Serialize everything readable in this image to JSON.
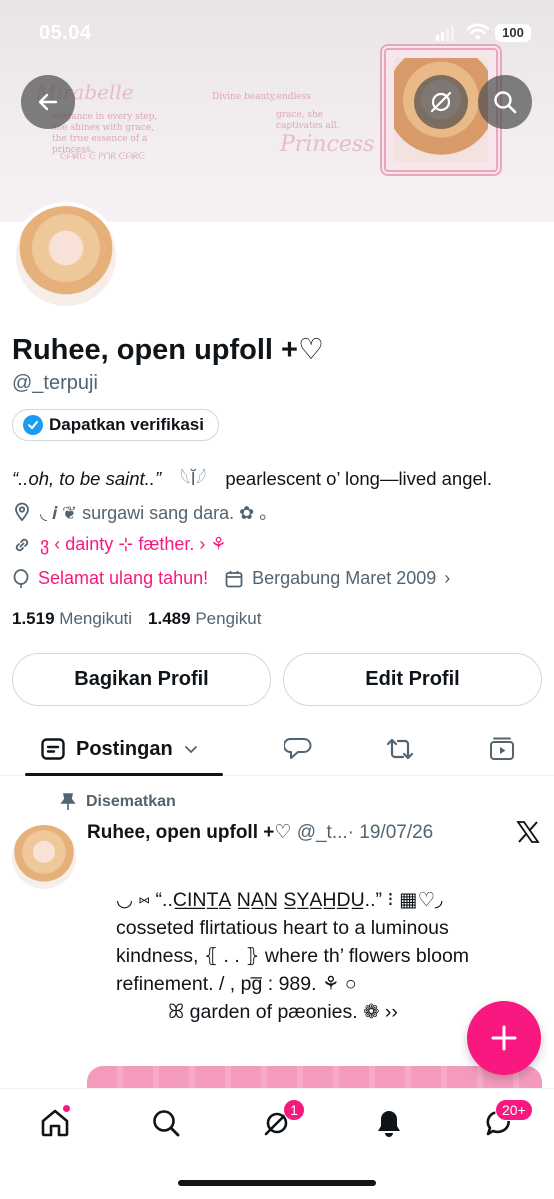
{
  "status_bar": {
    "time": "05.04",
    "battery": "100"
  },
  "banner": {
    "script_1": "Mirabelle",
    "script_2": "Princess",
    "text_1": "elegance in every step, she shines with grace, the true essence of a princess.",
    "text_2": "Divine beauty,endless",
    "text_3": "grace, she captivates all.",
    "text_4": "ᕮᗩᖇᕮ ᕮ ᑭᑎᖇ ᕮᗩᖇᕮ"
  },
  "profile": {
    "name": "Ruhee, open upfoll +♡",
    "handle": "@_terpuji",
    "verify_label": "Dapatkan verifikasi",
    "bio_quote": "“..oh, to be saint..”",
    "bio_rest": "pearlescent o’ long—lived angel.",
    "location": "◟ 𝒊 ❦ surgawi sang dara. ✿ 。",
    "link": "ვ ‹ dainty ⊹ fæther. › ⚘",
    "birthday": "Selamat ulang tahun!",
    "joined": "Bergabung Maret 2009",
    "following_count": "1.519",
    "following_label": "Mengikuti",
    "followers_count": "1.489",
    "followers_label": "Pengikut"
  },
  "actions": {
    "share": "Bagikan Profil",
    "edit": "Edit Profil"
  },
  "tabs": {
    "posts": "Postingan"
  },
  "pinned_post": {
    "pinned_label": "Disematkan",
    "author": "Ruhee, open upfoll +♡",
    "handle": "@_t...",
    "date": "· 19/07/26",
    "line_1": "◡ ⑅ “..C̲I̲N̲T̲A̲ N̲A̲N̲ S̲Y̲A̲H̲D̲U̲..” ⁝ ▦♡◞",
    "line_2": "cosseted flirtatious heart to a luminous",
    "line_3": "kindness, ⦃ . . ⦄ where th’ flowers bloom",
    "line_4": "refinement. / , pg̅ : 989. ⚘ ○",
    "line_5": "ꕤ garden of pæonies. ❁ ››"
  },
  "nav": {
    "notifications_badge": "1",
    "messages_badge": "20+"
  },
  "colors": {
    "accent": "#f91880",
    "verify_blue": "#1d9bf0",
    "secondary_text": "#536471"
  }
}
